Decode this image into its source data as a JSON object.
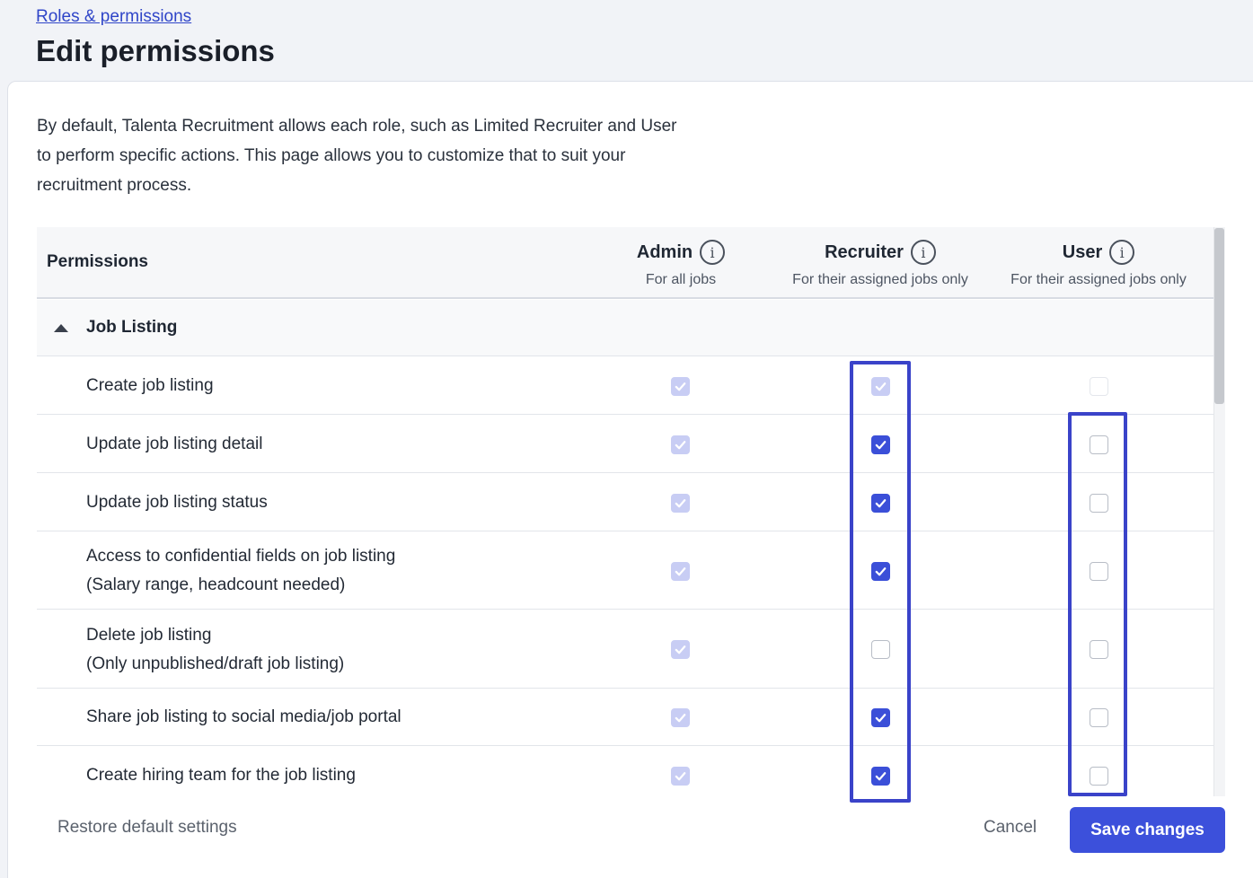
{
  "breadcrumb": "Roles & permissions",
  "page_title": "Edit permissions",
  "intro": "By default, Talenta Recruitment allows each role, such as Limited Recruiter and User to perform specific actions. This page allows you to customize that to suit your recruitment process.",
  "table": {
    "permissions_header": "Permissions",
    "roles": [
      {
        "name": "Admin",
        "sub": "For all jobs"
      },
      {
        "name": "Recruiter",
        "sub": "For their assigned jobs only"
      },
      {
        "name": "User",
        "sub": "For their assigned jobs only"
      }
    ],
    "group": "Job Listing",
    "rows": [
      {
        "line1": "Create job listing",
        "line2": "",
        "states": [
          "disabled-checked",
          "disabled-checked",
          "disabled-empty"
        ]
      },
      {
        "line1": "Update job listing detail",
        "line2": "",
        "states": [
          "disabled-checked",
          "checked",
          "empty"
        ]
      },
      {
        "line1": "Update job listing status",
        "line2": "",
        "states": [
          "disabled-checked",
          "checked",
          "empty"
        ]
      },
      {
        "line1": "Access to confidential fields on job listing",
        "line2": "(Salary range, headcount needed)",
        "states": [
          "disabled-checked",
          "checked",
          "empty"
        ]
      },
      {
        "line1": "Delete job listing",
        "line2": "(Only unpublished/draft job listing)",
        "states": [
          "disabled-checked",
          "empty",
          "empty"
        ]
      },
      {
        "line1": "Share job listing to social media/job portal",
        "line2": "",
        "states": [
          "disabled-checked",
          "checked",
          "empty"
        ]
      },
      {
        "line1": "Create hiring team for the job listing",
        "line2": "",
        "states": [
          "disabled-checked",
          "checked",
          "empty"
        ]
      }
    ]
  },
  "footer": {
    "restore_label": "Restore default settings",
    "cancel_label": "Cancel",
    "save_label": "Save changes"
  },
  "colors": {
    "accent": "#3c50db",
    "highlight": "#3a43c9"
  },
  "icons": {
    "info": "info-icon",
    "caret": "caret-up-icon",
    "check": "check-icon"
  }
}
